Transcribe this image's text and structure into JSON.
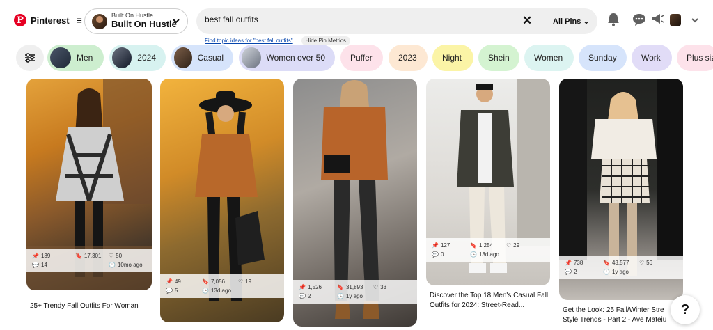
{
  "app": {
    "name": "Pinterest",
    "menu_glyph": "≡"
  },
  "profile": {
    "small": "Built On Hustle",
    "big": "Built On Hustle"
  },
  "search": {
    "value": "best fall outfits",
    "clear": "✕",
    "scope": "All Pins ⌄"
  },
  "sublinks": {
    "topic": "Find topic ideas for \"best fall outfits\"",
    "metrics": "Hide Pin Metrics"
  },
  "chips": [
    {
      "label": "Men",
      "bg": "#cdeecf"
    },
    {
      "label": "2024",
      "bg": "#d7f2f0"
    },
    {
      "label": "Casual",
      "bg": "#d6e4fb"
    },
    {
      "label": "Women over 50",
      "bg": "#dcdcf7"
    },
    {
      "label": "Puffer",
      "bg": "#fde2ea"
    },
    {
      "label": "2023",
      "bg": "#fde8d3"
    },
    {
      "label": "Night",
      "bg": "#fbf4a6"
    },
    {
      "label": "Shein",
      "bg": "#d4f3d1"
    },
    {
      "label": "Women",
      "bg": "#dcf4f1"
    },
    {
      "label": "Sunday",
      "bg": "#d6e4fb"
    },
    {
      "label": "Work",
      "bg": "#e1dcf7"
    },
    {
      "label": "Plus siz",
      "bg": "#fde2ea"
    }
  ],
  "pins": [
    {
      "saves": "139",
      "pins": "17,301",
      "likes": "50",
      "comments": "14",
      "age": "10mo ago",
      "title": "25+ Trendy Fall Outfits For Woman"
    },
    {
      "saves": "49",
      "pins": "7,056",
      "likes": "19",
      "comments": "5",
      "age": "13d ago",
      "title": ""
    },
    {
      "saves": "1,526",
      "pins": "31,893",
      "likes": "33",
      "comments": "2",
      "age": "1y ago",
      "title": ""
    },
    {
      "saves": "127",
      "pins": "1,254",
      "likes": "29",
      "comments": "0",
      "age": "13d ago",
      "title": "Discover the Top 18 Men's Casual Fall Outfits for 2024: Street-Read..."
    },
    {
      "saves": "738",
      "pins": "43,577",
      "likes": "56",
      "comments": "2",
      "age": "1y ago",
      "title": "Get the Look: 25 Fall/Winter Stre Style Trends - Part 2 - Ave Mateiu"
    }
  ],
  "help": "?",
  "colors": {
    "brand": "#e60023",
    "search_bg": "#efefef"
  }
}
